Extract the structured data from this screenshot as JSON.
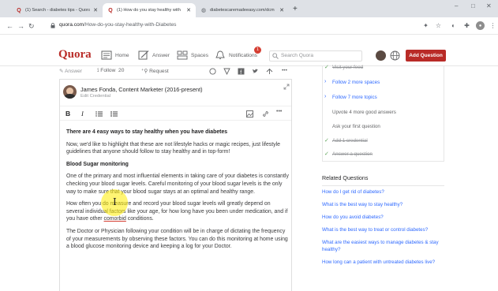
{
  "browser": {
    "tabs": [
      {
        "label": "(1) Search - diabetes tips - Quora",
        "favicon": "quora-q-icon",
        "active": false
      },
      {
        "label": "(1) How do you stay healthy with",
        "favicon": "quora-q-icon",
        "active": true
      },
      {
        "label": "diabetescaremadeeasy.com/dcm",
        "favicon": "globe-icon",
        "active": false
      }
    ],
    "url_host": "quora.com",
    "url_path": "/How-do-you-stay-healthy-with-Diabetes",
    "window_controls": [
      "–",
      "□",
      "✕"
    ]
  },
  "quora_header": {
    "logo": "Quora",
    "nav": {
      "home": "Home",
      "answer": "Answer",
      "spaces": "Spaces",
      "notifications": "Notifications"
    },
    "notification_count": "1",
    "search_placeholder": "Search Quora",
    "add_question": "Add Question",
    "brand_color": "#b92b27"
  },
  "action_bar": {
    "answer": "Answer",
    "follow": "Follow",
    "follow_count": "20",
    "request": "Request"
  },
  "editor": {
    "author": "James Fonda, Content Marketer (2016-present)",
    "edit_credential": "Edit Credential",
    "toolbar": {
      "bold": "B",
      "italic": "I"
    },
    "content": {
      "heading1": "There are 4 easy ways to stay healthy when you have diabetes",
      "p1": "Now, we'd like to highlight that these are not lifestyle hacks or magic recipes, just lifestyle guidelines that anyone should follow to stay healthy and in top-form!",
      "heading2": "Blood Sugar monitoring",
      "p2": "One of the primary and most influential elements in taking care of your diabetes is constantly checking your blood sugar levels. Careful monitoring of your blood sugar levels is the only way to make sure that your blood sugar stays at an optimal and healthy range.",
      "p3_before": "How often you do measure and record your blood sugar levels will greatly depend on several individual factors like your age, for how long have you been under medication, and if you have other ",
      "p3_underlined": "comorbid",
      "p3_after": " conditions.",
      "p4": "The Doctor or Physician following your condition will be in charge of dictating the frequency of your measurements by observing these factors. You can do this monitoring at home using a blood glucose monitoring device and keeping a log for your Doctor."
    }
  },
  "sidebar": {
    "checklist": [
      {
        "label": "Visit your feed",
        "state": "done"
      },
      {
        "label": "Follow 2 more spaces",
        "state": "link"
      },
      {
        "label": "Follow 7 more topics",
        "state": "link"
      },
      {
        "label": "Upvote 4 more good answers",
        "state": "plain"
      },
      {
        "label": "Ask your first question",
        "state": "plain"
      },
      {
        "label": "Add 1 credential",
        "state": "done"
      },
      {
        "label": "Answer a question",
        "state": "done"
      }
    ],
    "related_title": "Related Questions",
    "related_questions": [
      "How do I get rid of diabetes?",
      "What is the best way to stay healthy?",
      "How do you avoid diabetes?",
      "What is the best way to treat or control diabetes?",
      "What are the easiest ways to manage diabetes & stay healthy?",
      "How long can a patient with untreated diabetes live?"
    ]
  }
}
